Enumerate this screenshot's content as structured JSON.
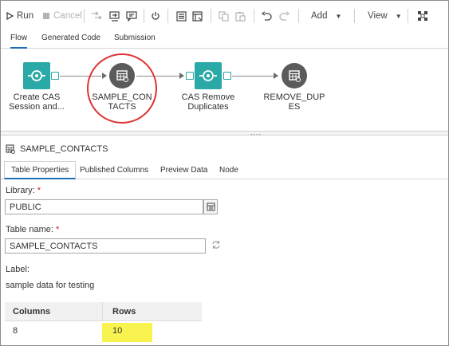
{
  "toolbar": {
    "run_label": "Run",
    "cancel_label": "Cancel",
    "add_label": "Add",
    "view_label": "View"
  },
  "top_tabs": [
    "Flow",
    "Generated Code",
    "Submission"
  ],
  "flow": {
    "nodes": [
      {
        "label": "Create CAS Session and...",
        "icon": "cas-session-icon",
        "color": "#2aa9a6"
      },
      {
        "label": "SAMPLE_CON TACTS",
        "icon": "table-icon",
        "color": "#5b5b5b"
      },
      {
        "label": "CAS Remove Duplicates",
        "icon": "remove-duplicates-icon",
        "color": "#2aa9a6"
      },
      {
        "label": "REMOVE_DUP ES",
        "icon": "table-icon",
        "color": "#5b5b5b"
      }
    ],
    "splitter_grip": "....",
    "callout_color": "#dd3333"
  },
  "detail": {
    "title": "SAMPLE_CONTACTS",
    "tabs": [
      "Table Properties",
      "Published Columns",
      "Preview Data",
      "Node"
    ],
    "library_label": "Library:",
    "library_value": "PUBLIC",
    "table_name_label": "Table name:",
    "table_name_value": "SAMPLE_CONTACTS",
    "required_mark": "*",
    "label_label": "Label:",
    "label_value": "sample data for testing",
    "grid": {
      "headers": [
        "Columns",
        "Rows"
      ],
      "values": [
        "8",
        "10"
      ]
    },
    "highlight_color": "#f8f34e"
  }
}
